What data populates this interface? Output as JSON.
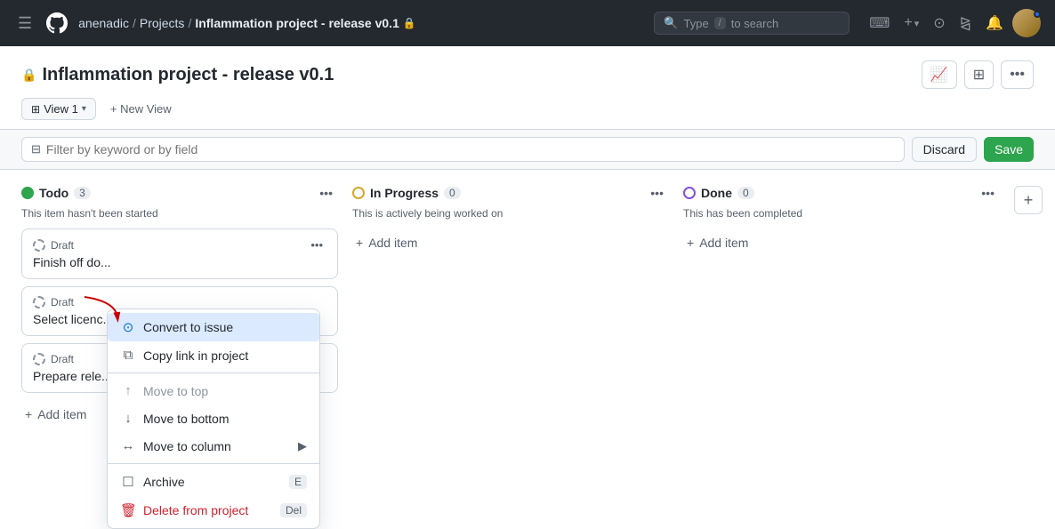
{
  "topnav": {
    "breadcrumb": {
      "user": "anenadic",
      "separator1": "/",
      "projects": "Projects",
      "separator2": "/",
      "current": "Inflammation project - release v0.1"
    },
    "search": {
      "prefix": "Type",
      "shortcut": "/",
      "suffix": "to search"
    },
    "actions": {
      "plus_label": "+",
      "terminal_label": ">_",
      "pullrequest_label": "⌥",
      "notifications_label": "🔔"
    }
  },
  "page": {
    "title": "Inflammation project - release v0.1",
    "lock_icon": "🔒"
  },
  "toolbar": {
    "view_tab_label": "View 1",
    "new_view_label": "+ New View",
    "filter_placeholder": "Filter by keyword or by field",
    "discard_label": "Discard",
    "save_label": "Save"
  },
  "columns": [
    {
      "id": "todo",
      "title": "Todo",
      "count": "3",
      "description": "This item hasn't been started",
      "status": "green",
      "cards": [
        {
          "label": "Draft",
          "title": "Finish off do..."
        },
        {
          "label": "Draft",
          "title": "Select licenc..."
        },
        {
          "label": "Draft",
          "title": "Prepare rele..."
        }
      ],
      "add_label": "Add item"
    },
    {
      "id": "in-progress",
      "title": "In Progress",
      "count": "0",
      "description": "This is actively being worked on",
      "status": "yellow",
      "cards": [],
      "add_label": "Add item"
    },
    {
      "id": "done",
      "title": "Done",
      "count": "0",
      "description": "This has been completed",
      "status": "purple",
      "cards": [],
      "add_label": "Add item"
    }
  ],
  "context_menu": {
    "items": [
      {
        "id": "convert-to-issue",
        "icon": "⊙",
        "label": "Convert to issue",
        "highlighted": true
      },
      {
        "id": "copy-link",
        "icon": "⧉",
        "label": "Copy link in project"
      },
      {
        "id": "divider1"
      },
      {
        "id": "move-to-top",
        "icon": "↑",
        "label": "Move to top",
        "disabled": true
      },
      {
        "id": "move-to-bottom",
        "icon": "↓",
        "label": "Move to bottom"
      },
      {
        "id": "move-to-column",
        "icon": "↔",
        "label": "Move to column",
        "has_arrow": true
      },
      {
        "id": "divider2"
      },
      {
        "id": "archive",
        "icon": "☐",
        "label": "Archive",
        "kbd": "E"
      },
      {
        "id": "delete",
        "icon": "🗑",
        "label": "Delete from project",
        "kbd": "Del",
        "delete": true
      }
    ]
  }
}
